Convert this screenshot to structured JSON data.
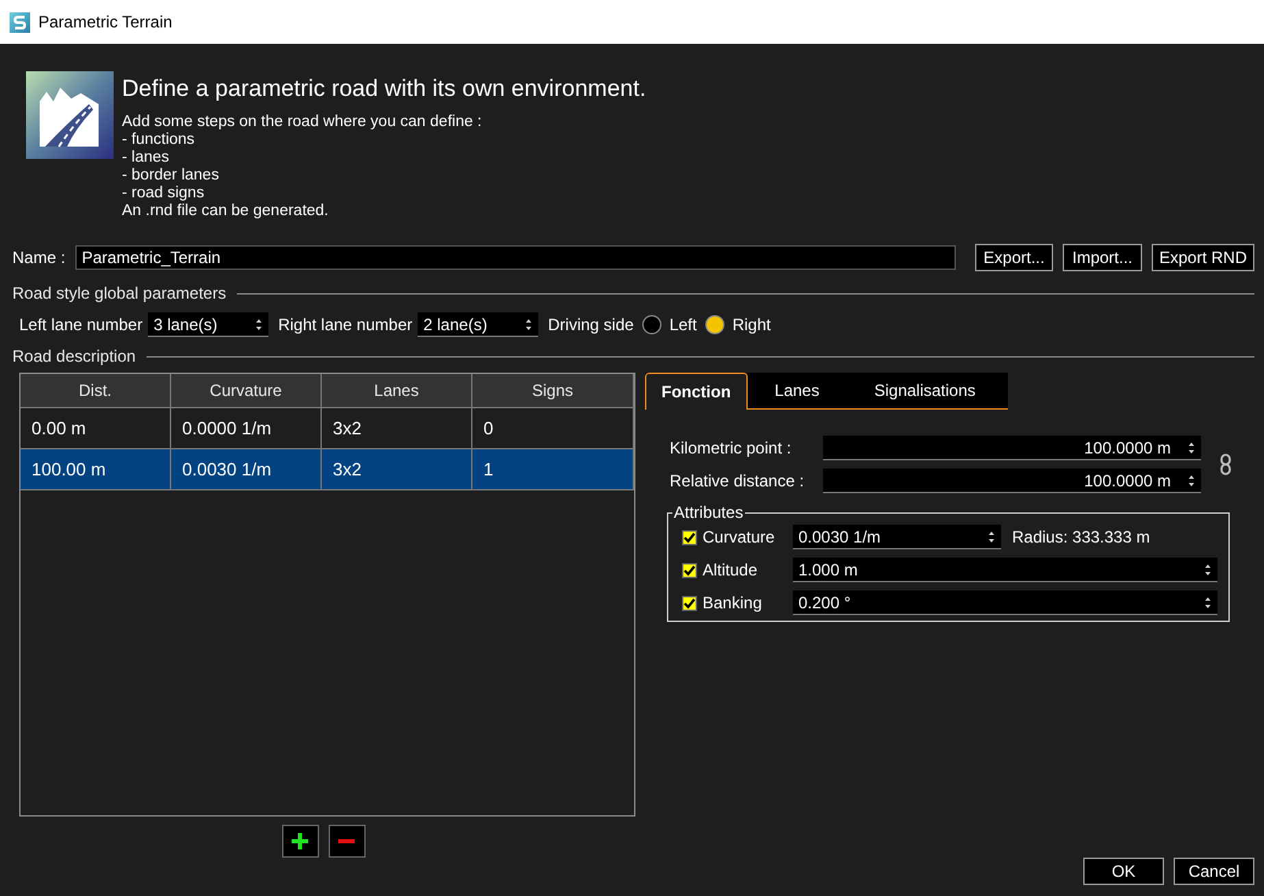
{
  "window": {
    "title": "Parametric Terrain"
  },
  "header": {
    "title": "Define a parametric road with its own environment.",
    "description": [
      "Add some steps on the road where you can define :",
      "- functions",
      "- lanes",
      "- border lanes",
      "- road signs",
      "An .rnd file can be generated."
    ]
  },
  "name_field": {
    "label": "Name :",
    "value": "Parametric_Terrain"
  },
  "top_buttons": [
    "Export...",
    "Import...",
    "Export RND"
  ],
  "global_parameters": {
    "title": "Road style global parameters",
    "left_lane": {
      "label": "Left lane number",
      "value": "3 lane(s)"
    },
    "right_lane": {
      "label": "Right lane number",
      "value": "2 lane(s)"
    },
    "driving_side": {
      "label": "Driving side",
      "options": [
        {
          "label": "Left",
          "selected": false
        },
        {
          "label": "Right",
          "selected": true
        }
      ]
    }
  },
  "road_description": {
    "title": "Road description",
    "table": {
      "columns": [
        "Dist.",
        "Curvature",
        "Lanes",
        "Signs"
      ],
      "rows": [
        {
          "cells": [
            "0.00 m",
            "0.0000 1/m",
            "3x2",
            "0"
          ],
          "selected": false
        },
        {
          "cells": [
            "100.00 m",
            "0.0030 1/m",
            "3x2",
            "1"
          ],
          "selected": true
        }
      ]
    }
  },
  "tabs": [
    {
      "label": "Fonction",
      "selected": true
    },
    {
      "label": "Lanes",
      "selected": false
    },
    {
      "label": "Signalisations",
      "selected": false
    }
  ],
  "fonction": {
    "kilometric_point": {
      "label": "Kilometric point :",
      "value": "100.0000 m"
    },
    "relative_distance": {
      "label": "Relative distance :",
      "value": "100.0000 m"
    },
    "attributes": {
      "title": "Attributes",
      "items": [
        {
          "label": "Curvature",
          "checked": true,
          "value": "0.0030 1/m",
          "note": "Radius: 333.333 m"
        },
        {
          "label": "Altitude",
          "checked": true,
          "value": "1.000 m"
        },
        {
          "label": "Banking",
          "checked": true,
          "value": "0.200 °"
        }
      ]
    }
  },
  "dialog_buttons": [
    "OK",
    "Cancel"
  ]
}
